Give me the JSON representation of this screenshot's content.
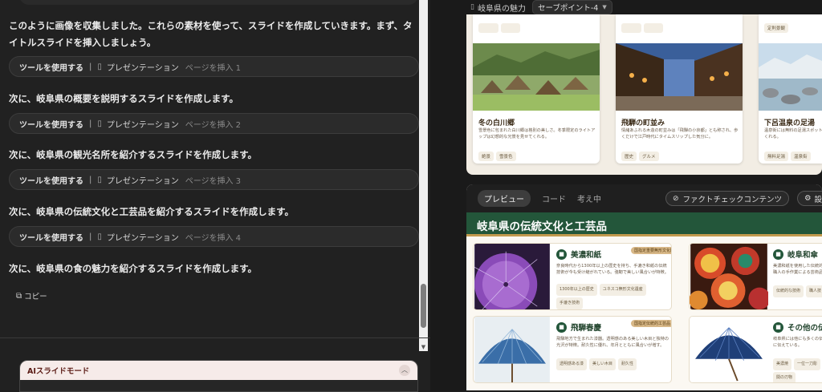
{
  "chat": {
    "intro": "このように画像を収集しました。これらの素材を使って、スライドを作成していきます。まず、タイトルスライドを挿入しましょう。",
    "steps": [
      {
        "text": "次に、岐阜県の概要を説明するスライドを作成します。"
      },
      {
        "text": "次に、岐阜県の観光名所を紹介するスライドを作成します。"
      },
      {
        "text": "次に、岐阜県の伝統文化と工芸品を紹介するスライドを作成します。"
      },
      {
        "text": "次に、岐阜県の食の魅力を紹介するスライドを作成します。"
      }
    ],
    "tools": [
      {
        "use": "ツールを使用する",
        "sep": "|",
        "icon": "presentation-icon",
        "name": "プレゼンテーション",
        "action": "ページを挿入 1"
      },
      {
        "use": "ツールを使用する",
        "sep": "|",
        "icon": "presentation-icon",
        "name": "プレゼンテーション",
        "action": "ページを挿入 2"
      },
      {
        "use": "ツールを使用する",
        "sep": "|",
        "icon": "presentation-icon",
        "name": "プレゼンテーション",
        "action": "ページを挿入 3"
      },
      {
        "use": "ツールを使用する",
        "sep": "|",
        "icon": "presentation-icon",
        "name": "プレゼンテーション",
        "action": "ページを挿入 4"
      }
    ],
    "copy_label": "コピー",
    "ai_mode_label": "AIスライドモード"
  },
  "right": {
    "doc_title": "岐阜県の魅力",
    "savepoint": "セーブポイント-4",
    "slide1_cards": [
      {
        "title": "冬の白川郷",
        "desc": "雪景色に包まれた白川郷は格別の美しさ。冬季限定のライトアップは幻想的な光景を見せてくれる。",
        "tags": [
          "絶景",
          "雪景色"
        ]
      },
      {
        "title": "飛騨の町並み",
        "desc": "情緒あふれる木造の町並みは「飛騨の小京都」とも称され、歩くだけで江戸時代にタイムスリップした気分に。",
        "tags": [
          "歴史",
          "グルメ"
        ]
      },
      {
        "title": "下呂温泉の足湯",
        "desc": "温泉街には無料の足湯スポットも点在し、散策の疲れを癒してくれる。",
        "tags": [
          "無料足湯",
          "温泉街"
        ]
      }
    ],
    "slide1_top_tags": [
      "定則景観"
    ],
    "tabs": {
      "preview": "プレビュー",
      "code": "コード",
      "thinking": "考え中"
    },
    "factcheck": "ファクトチェックコンテンツ",
    "settings_label": "設",
    "slide2_title": "岐阜県の伝統文化と工芸品",
    "crafts": [
      {
        "title": "美濃和紙",
        "badge": "国指定重要無形文化財",
        "desc": "奈良時代から1300年以上の歴史を持ち、手漉き和紙の伝統技術が今も受け継がれている。強靭で美しい風合いが特徴。",
        "tags": [
          "1300年以上の歴史",
          "ユネスコ無形文化遺産",
          "手漉き技術"
        ]
      },
      {
        "title": "岐阜和傘",
        "badge": "",
        "desc": "美濃和紙を使用した伝統的な和傘は、骨組みから仕上げまで職人の手作業による芸術品。",
        "tags": [
          "伝統的な技術",
          "職人技"
        ]
      },
      {
        "title": "飛騨春慶",
        "badge": "国指定伝統的工芸品",
        "desc": "飛騨地方で生まれた漆器。透明感のある美しい木目と独特の光沢が特徴。耐久性に優れ、年月とともに風合いが増す。",
        "tags": [
          "透明感ある漆",
          "美しい木目",
          "耐久性"
        ]
      },
      {
        "title": "その他の伝統工芸",
        "badge": "",
        "desc": "岐阜県には他にも多くの伝統工芸品があり、地域の文化を今に伝えている。",
        "tags": [
          "美濃焼",
          "一位一刀彫",
          "関の刃物"
        ]
      }
    ]
  }
}
